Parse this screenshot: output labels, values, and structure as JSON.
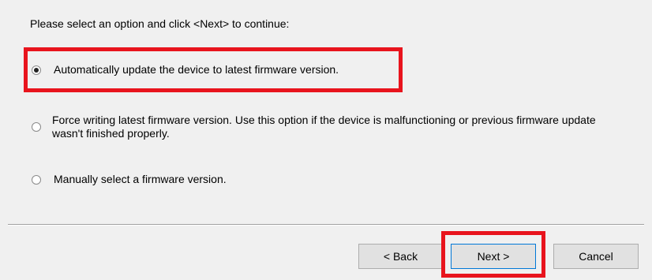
{
  "instruction": "Please select an option and click <Next> to continue:",
  "options": [
    {
      "label": "Automatically update the device to latest firmware version.",
      "selected": true
    },
    {
      "label": "Force writing latest firmware version. Use this option if the device is malfunctioning or previous firmware update wasn't finished properly.",
      "selected": false
    },
    {
      "label": "Manually select a firmware version.",
      "selected": false
    }
  ],
  "buttons": {
    "back": "< Back",
    "next": "Next >",
    "cancel": "Cancel"
  },
  "colors": {
    "highlight": "#e8141d",
    "background": "#f0f0f0",
    "button_face": "#e1e1e1",
    "default_button_border": "#0078d7"
  }
}
